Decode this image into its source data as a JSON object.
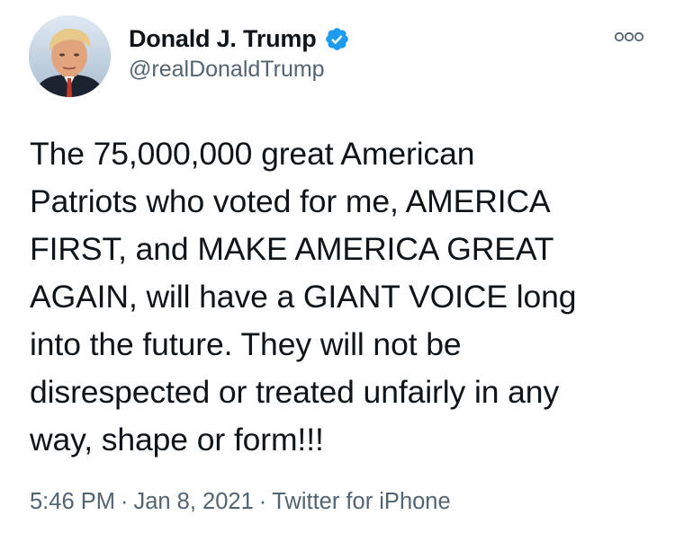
{
  "author": {
    "display_name": "Donald J. Trump",
    "handle": "@realDonaldTrump",
    "verified": true
  },
  "tweet": {
    "lines": [
      "The 75,000,000 great American",
      "Patriots who voted for me, AMERICA",
      "FIRST, and MAKE AMERICA GREAT",
      "AGAIN, will have a GIANT VOICE long",
      "into the future. They will not be",
      "disrespected or treated unfairly in any",
      "way, shape or form!!!"
    ]
  },
  "meta": {
    "time": "5:46 PM",
    "date": "Jan 8, 2021",
    "source": "Twitter for iPhone",
    "separator": "·"
  },
  "colors": {
    "text": "#0f1419",
    "secondary": "#536471",
    "verified": "#1d9bf0"
  },
  "icons": {
    "verified": "verified-badge-icon",
    "more": "more-options-icon"
  }
}
